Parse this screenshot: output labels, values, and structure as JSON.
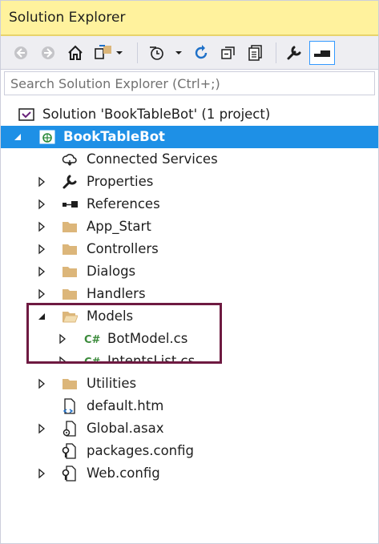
{
  "panel": {
    "title": "Solution Explorer"
  },
  "search": {
    "placeholder": "Search Solution Explorer (Ctrl+;)"
  },
  "tree": {
    "solution_label": "Solution 'BookTableBot' (1 project)",
    "project_label": "BookTableBot",
    "items": [
      {
        "label": "Connected Services",
        "icon": "cloud-icon"
      },
      {
        "label": "Properties",
        "icon": "wrench-icon"
      },
      {
        "label": "References",
        "icon": "references-icon"
      },
      {
        "label": "App_Start",
        "icon": "folder-icon"
      },
      {
        "label": "Controllers",
        "icon": "folder-icon"
      },
      {
        "label": "Dialogs",
        "icon": "folder-icon"
      },
      {
        "label": "Handlers",
        "icon": "folder-icon"
      },
      {
        "label": "Models",
        "icon": "folder-open-icon"
      },
      {
        "label": "BotModel.cs",
        "icon": "csharp-file-icon"
      },
      {
        "label": "IntentsList.cs",
        "icon": "csharp-file-icon"
      },
      {
        "label": "Utilities",
        "icon": "folder-icon"
      },
      {
        "label": "default.htm",
        "icon": "html-file-icon"
      },
      {
        "label": "Global.asax",
        "icon": "asax-file-icon"
      },
      {
        "label": "packages.config",
        "icon": "config-file-icon"
      },
      {
        "label": "Web.config",
        "icon": "config-file-icon"
      }
    ]
  },
  "colors": {
    "title_bg": "#fff29d",
    "selection": "#1e90e6",
    "highlight_box": "#6e1a41",
    "folder": "#dcb67a"
  }
}
